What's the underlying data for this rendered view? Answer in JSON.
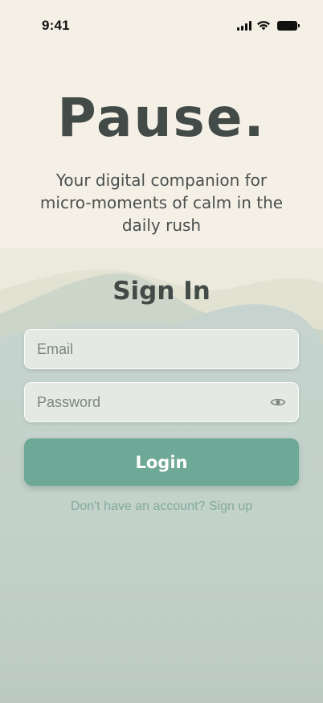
{
  "status_bar": {
    "time": "9:41",
    "icons": [
      "signal-icon",
      "wifi-icon",
      "battery-icon"
    ]
  },
  "brand": {
    "title": "Pause."
  },
  "tagline": "Your digital companion for micro-moments of calm in the daily rush",
  "form": {
    "title": "Sign In",
    "email": {
      "placeholder": "Email",
      "value": ""
    },
    "password": {
      "placeholder": "Password",
      "value": "",
      "toggle_icon": "eye-icon"
    },
    "login_label": "Login",
    "signup_text": "Don't have an account? Sign up"
  },
  "colors": {
    "background": "#f4f0e6",
    "text": "#434b48",
    "accent": "#6ea896",
    "link": "#82aa9c"
  }
}
